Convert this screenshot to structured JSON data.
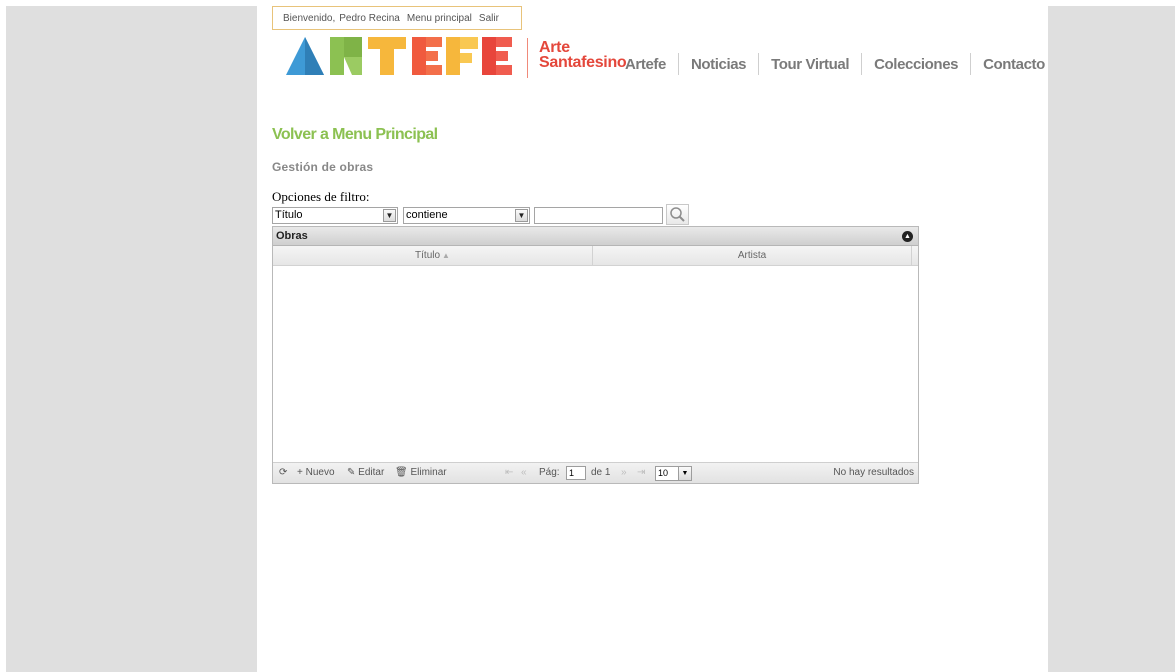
{
  "userbar": {
    "welcome": "Bienvenido,",
    "user_name": "Pedro Recina",
    "menu_link": "Menu principal",
    "logout_link": "Salir"
  },
  "brand": {
    "line1": "Arte",
    "line2": "Santafesino"
  },
  "nav": {
    "items": [
      "Artefe",
      "Noticias",
      "Tour Virtual",
      "Colecciones",
      "Contacto"
    ]
  },
  "back_link": "Volver a Menu Principal",
  "section_title": "Gestión de obras",
  "filter": {
    "label": "Opciones de filtro:",
    "field_value": "Título",
    "operator_value": "contiene",
    "search_value": ""
  },
  "grid": {
    "caption": "Obras",
    "columns": [
      "Título",
      "Artista"
    ],
    "rows": [],
    "toolbar": {
      "new_label": "Nuevo",
      "edit_label": "Editar",
      "delete_label": "Eliminar"
    },
    "pager": {
      "page_label": "Pág:",
      "page_value": "1",
      "of_label": "de 1",
      "rows_per_page": "10",
      "status": "No hay resultados"
    }
  },
  "colors": {
    "accent_green": "#8cc152",
    "brand_red": "#e4473b",
    "side_gray": "#dfdfdf"
  }
}
